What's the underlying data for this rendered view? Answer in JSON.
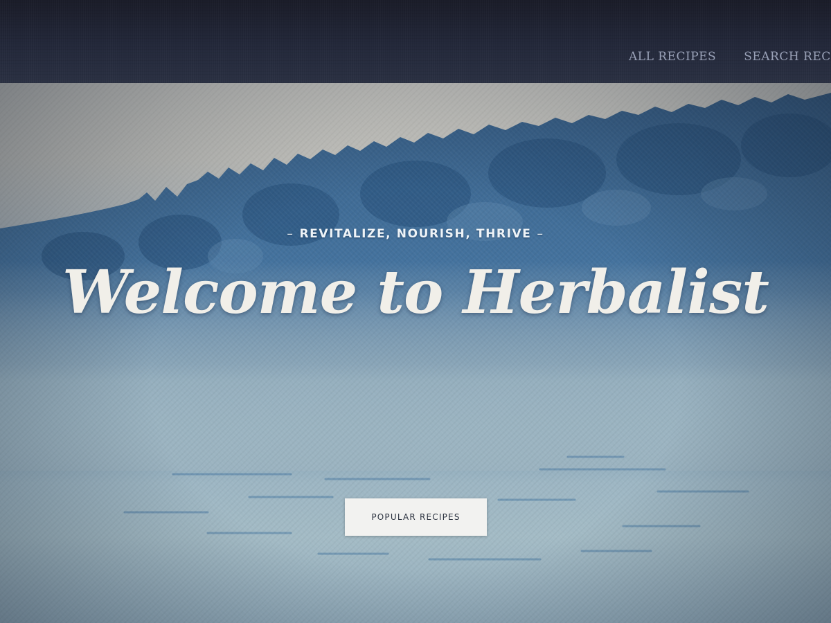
{
  "nav": {
    "links": [
      {
        "label": "ALL RECIPES"
      },
      {
        "label": "SEARCH RECIPES"
      }
    ]
  },
  "hero": {
    "tagline_dash": "–",
    "tagline": "REVITALIZE, NOURISH, THRIVE",
    "headline": "Welcome to Herbalist",
    "cta_label": "POPULAR RECIPES"
  },
  "colors": {
    "nav_bg": "#23283a",
    "nav_text": "#9aa2b8",
    "forest_dark": "#2f5a86",
    "forest_mid": "#3f6f9c",
    "mist": "#a3bbc5",
    "headline": "#f1efe9",
    "button_bg": "#f2f2f0",
    "button_text": "#2c3340"
  }
}
